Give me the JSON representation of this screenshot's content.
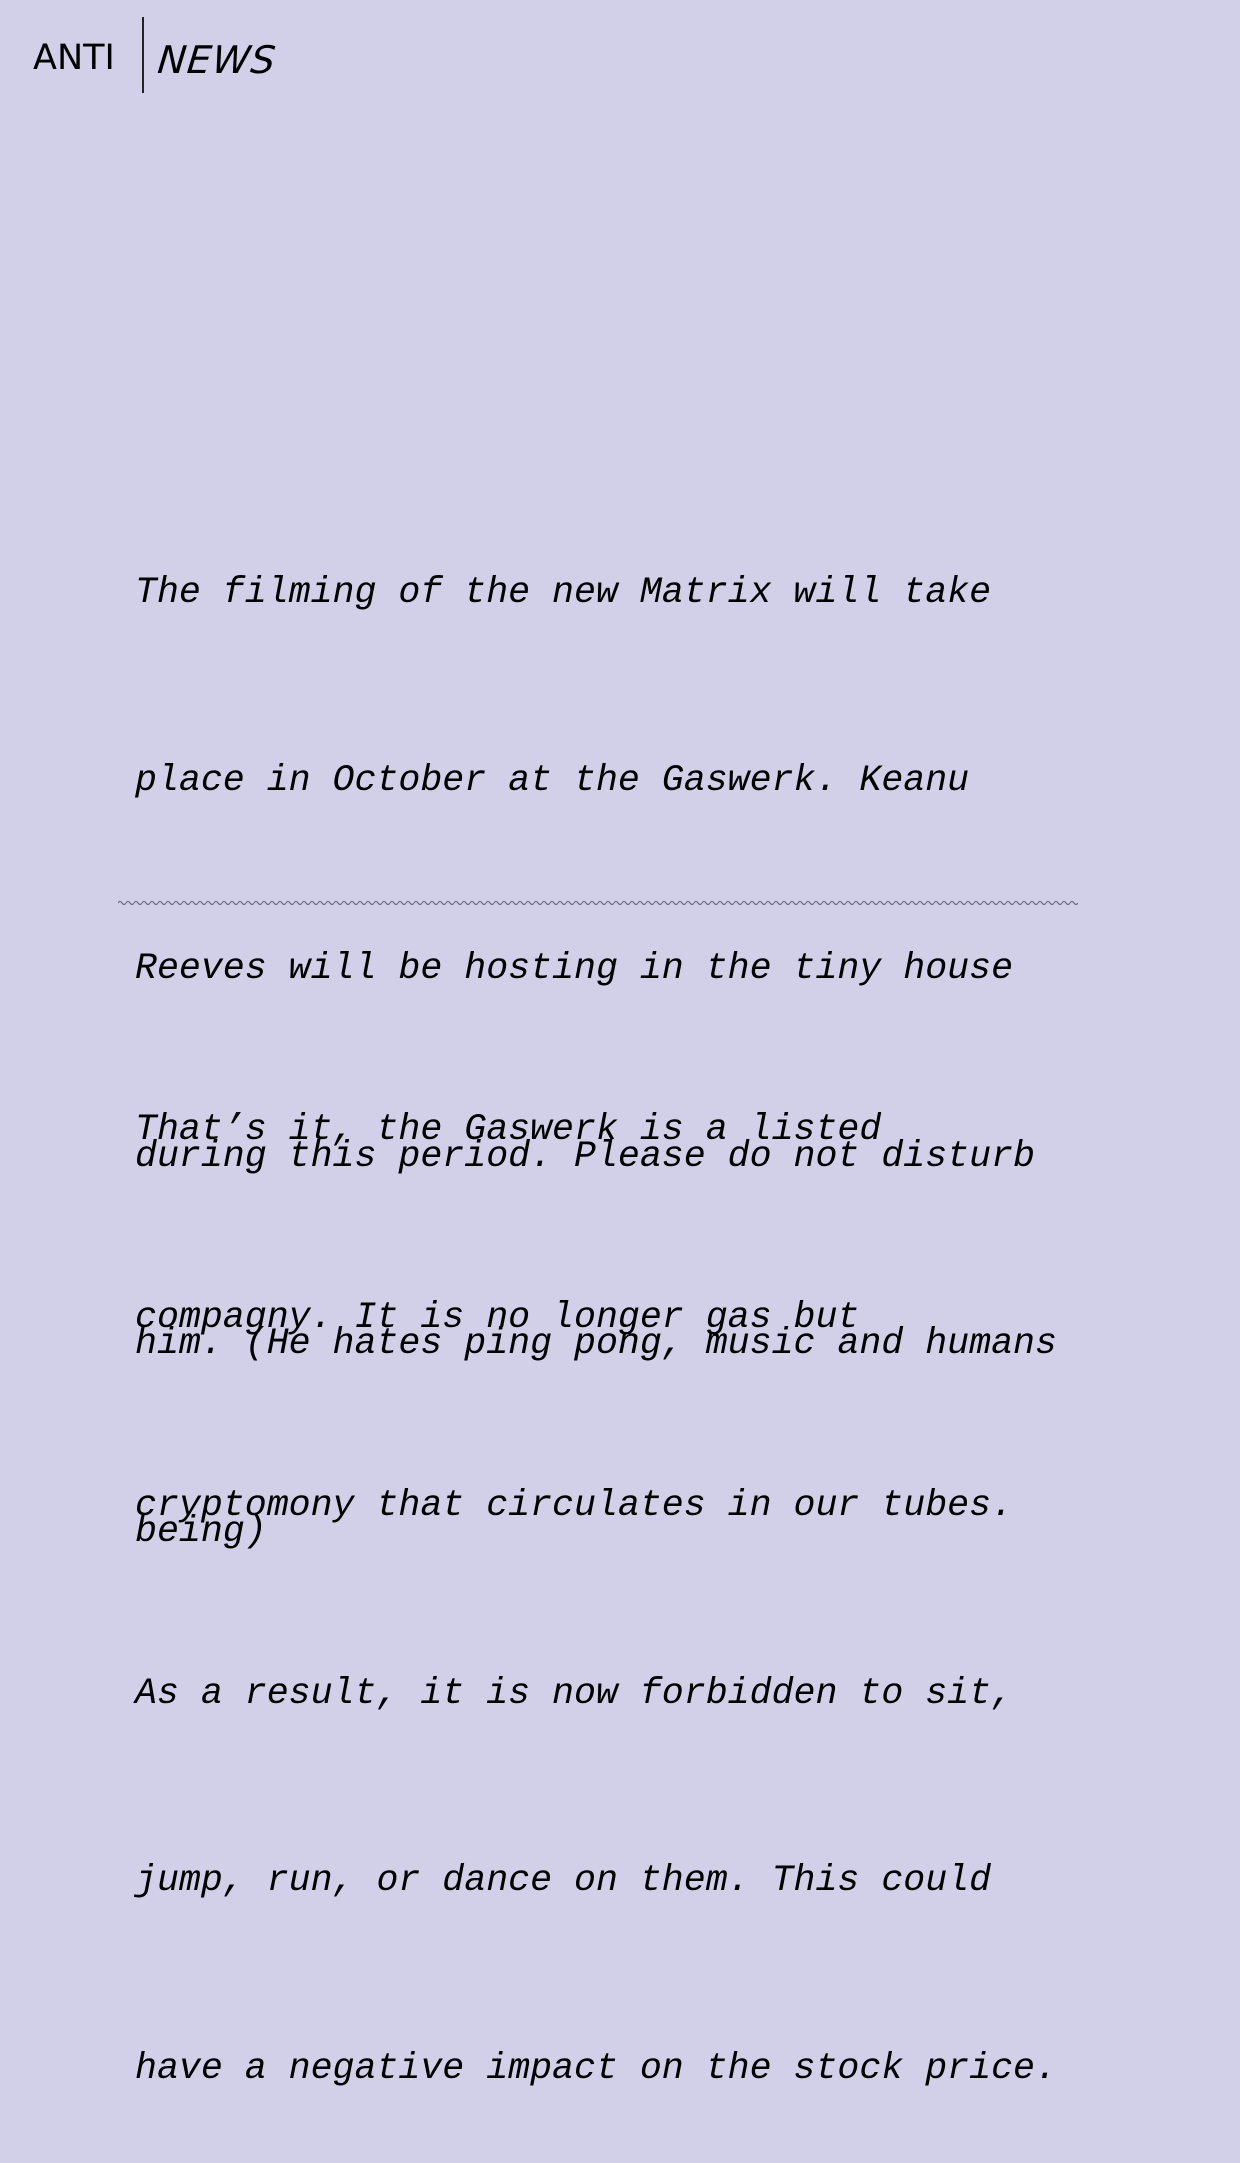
{
  "header": {
    "logo_left": "ANTI",
    "logo_right": "NEWS"
  },
  "articles": [
    {
      "lines": [
        "The filming of the new Matrix will take",
        "place in October at the Gaswerk. Keanu",
        "Reeves will be hosting in the tiny house",
        "during this period. Please do not disturb",
        "him. (He hates ping pong, music and humans",
        "being)"
      ]
    },
    {
      "lines": [
        "That’s it, the Gaswerk is a listed",
        "compagny. It is no longer gas but",
        "cryptomony that circulates in our tubes.",
        "As a result, it is now forbidden to sit,",
        "jump, run, or dance on them. This could",
        "have a negative impact on the stock price."
      ]
    }
  ],
  "colors": {
    "background": "#d2d0e8",
    "divider": "#6a6a80"
  }
}
